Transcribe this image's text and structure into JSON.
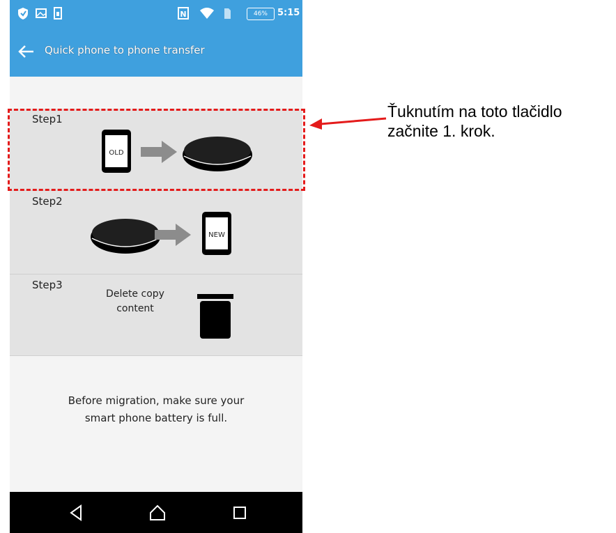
{
  "status_bar": {
    "battery": "46%",
    "time": "5:15",
    "icons": [
      "shield-icon",
      "image-icon",
      "sim-icon",
      "nfc-icon",
      "wifi-icon",
      "sim-card-icon",
      "battery-icon"
    ]
  },
  "app_bar": {
    "title": "Quick phone to phone transfer",
    "back_icon": "arrow-left-icon"
  },
  "steps": [
    {
      "label": "Step1",
      "old_phone_text": "OLD"
    },
    {
      "label": "Step2",
      "new_phone_text": "NEW"
    },
    {
      "label": "Step3",
      "description_line1": "Delete copy",
      "description_line2": "content"
    }
  ],
  "note": {
    "line1": "Before migration, make sure your",
    "line2": "smart phone battery is full."
  },
  "nav_bar": {
    "icons": [
      "back-triangle-icon",
      "home-icon",
      "recents-icon"
    ]
  },
  "annotation": {
    "line1": "Ťuknutím na toto tlačidlo",
    "line2": "začnite 1. krok.",
    "color": "#e41b1b"
  },
  "colors": {
    "accent": "#3fa0de",
    "step_bg": "#e3e3e3",
    "nav_bg": "#000000"
  }
}
